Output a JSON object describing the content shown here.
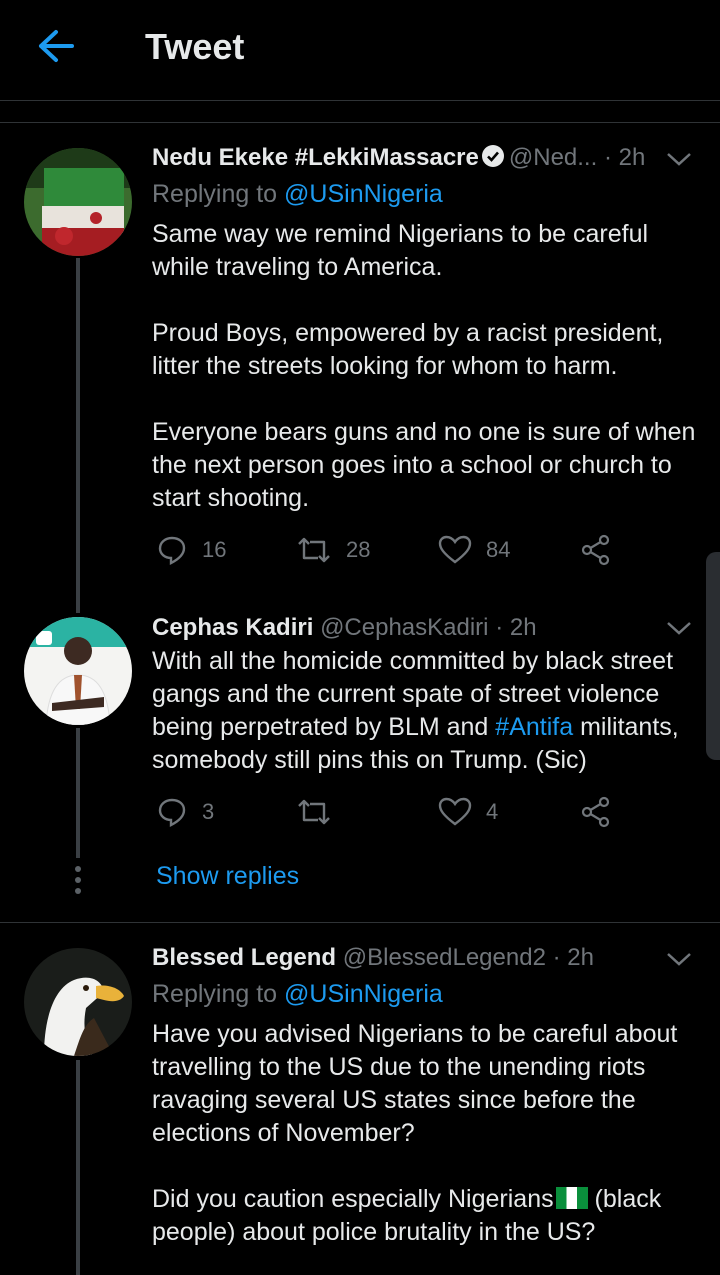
{
  "header": {
    "title": "Tweet"
  },
  "tweets": [
    {
      "name": "Nedu Ekeke #LekkiMassacre",
      "handle": "@Ned...",
      "time": "· 2h",
      "replying_prefix": "Replying to ",
      "replying_to": "@USinNigeria",
      "paragraphs": [
        "Same way we remind Nigerians to be careful while traveling to America.",
        "Proud Boys, empowered by a racist president, litter the streets looking for whom to harm.",
        "Everyone bears guns and no one is sure of when the next person goes into a school or church to start shooting."
      ],
      "replies": "16",
      "retweets": "28",
      "likes": "84"
    },
    {
      "name": "Cephas Kadiri",
      "handle": "@CephasKadiri",
      "time": "· 2h",
      "text_before": "With all the homicide committed by black street gangs and the current spate of street violence being perpetrated by BLM and ",
      "hashtag": "#Antifa",
      "text_after": " militants, somebody still pins this on Trump. (Sic)",
      "replies": "3",
      "retweets": "",
      "likes": "4",
      "show_replies": "Show replies"
    },
    {
      "name": "Blessed Legend",
      "handle": "@BlessedLegend2",
      "time": "· 2h",
      "replying_prefix": "Replying to ",
      "replying_to": "@USinNigeria",
      "paragraph1": "Have you advised Nigerians to be careful about travelling to the US due to the unending riots ravaging several US states since before the elections of November?",
      "paragraph2_before": "Did you caution especially Nigerians",
      "paragraph2_after": " (black people) about police brutality in the US?"
    }
  ],
  "colors": {
    "accent": "#1d9bf0",
    "muted": "#71767b",
    "text": "#e7e9ea",
    "background": "#000000"
  }
}
